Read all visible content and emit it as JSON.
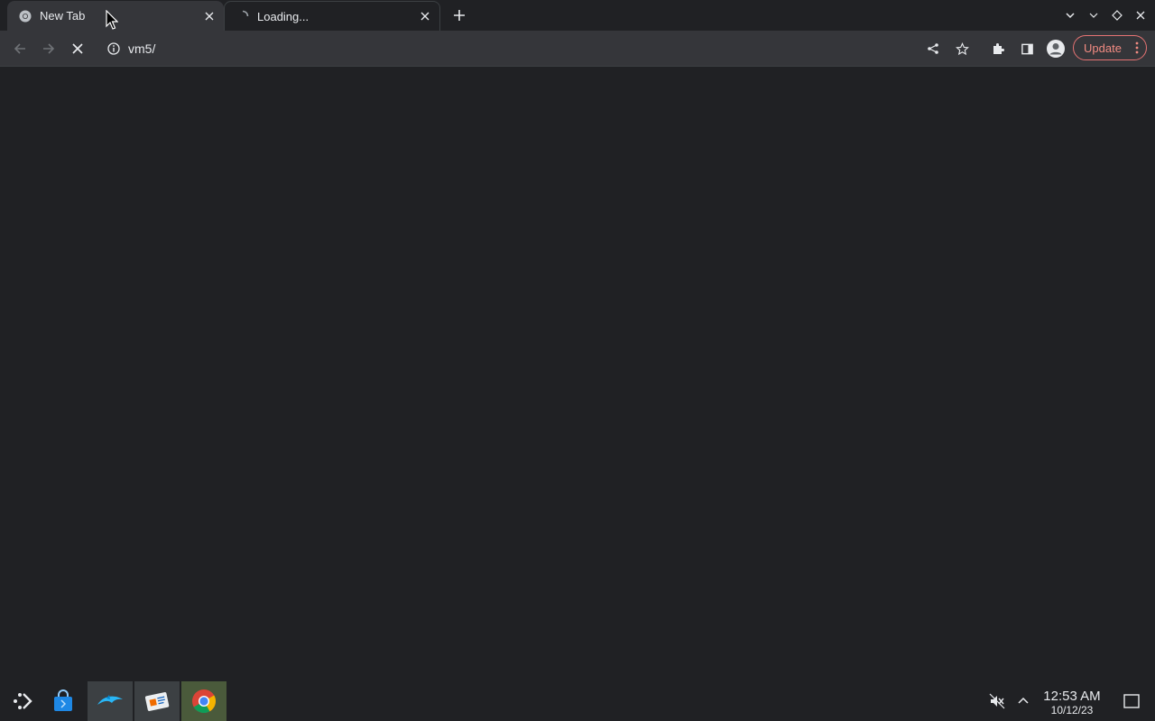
{
  "tabs": [
    {
      "title": "New Tab",
      "icon": "chrome-icon",
      "active": true
    },
    {
      "title": "Loading...",
      "icon": "loading-spinner-icon",
      "active": false
    }
  ],
  "toolbar": {
    "url": "vm5/",
    "update_label": "Update"
  },
  "taskbar": {
    "apps": [
      "app-launcher-icon",
      "store-icon",
      "dolphin-file-manager-icon",
      "contacts-icon",
      "chrome-icon"
    ],
    "time": "12:53 AM",
    "date": "10/12/23"
  },
  "colors": {
    "background": "#202124",
    "toolbar": "#35363a",
    "update_accent": "#f28b82"
  }
}
